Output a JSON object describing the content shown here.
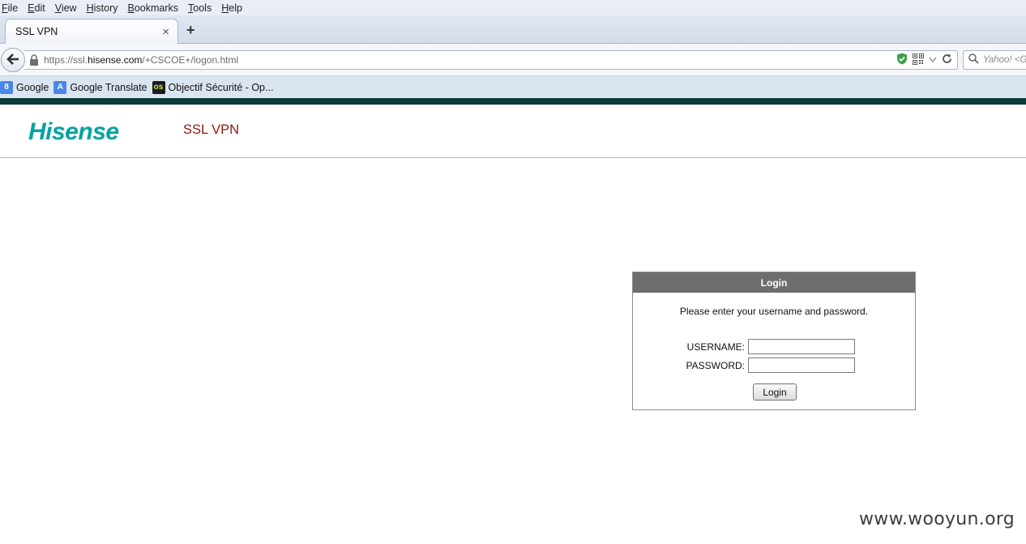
{
  "browser": {
    "menu": [
      {
        "label": "File",
        "key": "F",
        "rest": "ile"
      },
      {
        "label": "Edit",
        "key": "E",
        "rest": "dit"
      },
      {
        "label": "View",
        "key": "V",
        "rest": "iew"
      },
      {
        "label": "History",
        "key": "H",
        "rest": "istory"
      },
      {
        "label": "Bookmarks",
        "key": "B",
        "rest": "ookmarks"
      },
      {
        "label": "Tools",
        "key": "T",
        "rest": "ools"
      },
      {
        "label": "Help",
        "key": "H",
        "rest": "elp"
      }
    ],
    "tab": {
      "title": "SSL VPN",
      "close": "×"
    },
    "new_tab": "+",
    "url": {
      "prefix": "https://ssl.",
      "domain": "hisense.com",
      "path": "/+CSCOE+/logon.html"
    },
    "search_placeholder": "Yahoo! <G",
    "bookmarks": [
      {
        "label": "Google",
        "icon": "google-icon",
        "icon_text": "8",
        "color": "#4a86e8"
      },
      {
        "label": "Google Translate",
        "icon": "translate-icon",
        "icon_text": "A",
        "color": "#4a86e8"
      },
      {
        "label": "Objectif Sécurité - Op...",
        "icon": "os-icon",
        "icon_text": "os",
        "color": "#1c1c1c"
      }
    ]
  },
  "page": {
    "logo": "Hisense",
    "product_title": "SSL VPN",
    "login": {
      "heading": "Login",
      "prompt": "Please enter your username and password.",
      "username_label": "USERNAME:",
      "username_value": "",
      "password_label": "PASSWORD:",
      "password_value": "",
      "button_label": "Login"
    }
  },
  "watermark": "www.wooyun.org",
  "colors": {
    "brand_teal": "#00a3a0",
    "title_red": "#8b1a10",
    "login_header": "#6d6d6d",
    "top_stripe": "#0b3b37"
  }
}
